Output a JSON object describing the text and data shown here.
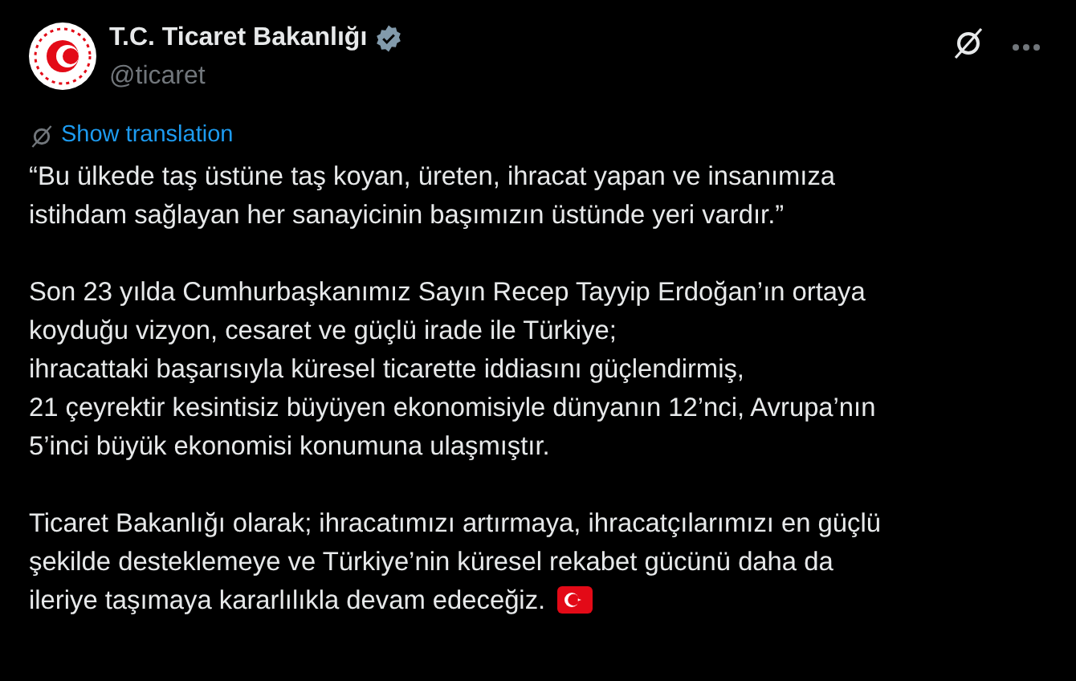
{
  "account": {
    "name": "T.C. Ticaret Bakanlığı",
    "handle": "@ticaret",
    "verified": true
  },
  "translation_link": "Show translation",
  "paragraphs": [
    [
      "“Bu ülkede taş üstüne taş koyan, üreten, ihracat yapan ve insanımıza",
      "istihdam sağlayan her sanayicinin başımızın üstünde yeri vardır.”"
    ],
    [
      "Son 23 yılda Cumhurbaşkanımız Sayın Recep Tayyip Erdoğan’ın ortaya",
      "koyduğu vizyon, cesaret ve güçlü irade ile Türkiye;",
      "ihracattaki başarısıyla küresel ticarette iddiasını güçlendirmiş,",
      "21 çeyrektir kesintisiz büyüyen ekonomisiyle dünyanın 12’nci, Avrupa’nın",
      "5’inci büyük ekonomisi konumuna ulaşmıştır."
    ],
    [
      "Ticaret Bakanlığı olarak; ihracatımızı artırmaya, ihracatçılarımızı en güçlü",
      "şekilde desteklemeye ve Türkiye’nin küresel rekabet gücünü daha da",
      "ileriye taşımaya kararlılıkla devam edeceğiz."
    ]
  ]
}
